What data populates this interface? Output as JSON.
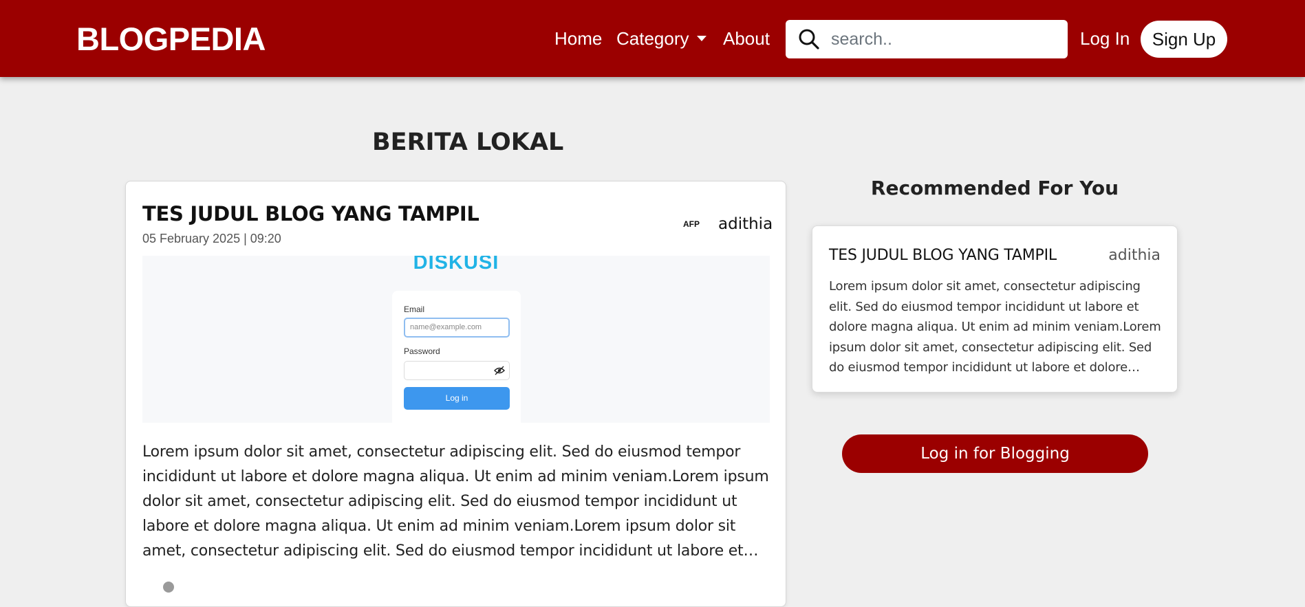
{
  "navbar": {
    "brand": "BLOGPEDIA",
    "links": {
      "home": "Home",
      "category": "Category",
      "about": "About",
      "login": "Log In",
      "signup": "Sign Up"
    },
    "search": {
      "placeholder": "search..",
      "value": ""
    },
    "colors": {
      "background": "#9b0000",
      "text": "#ffffff"
    }
  },
  "section": {
    "title": "BERITA LOKAL"
  },
  "post": {
    "title": "TES JUDUL BLOG YANG TAMPIL",
    "date": "05 February 2025 | 09:20",
    "source": "AFP",
    "author": "adithia",
    "image": {
      "heading": "DISKUSI",
      "email_label": "Email",
      "email_placeholder": "name@example.com",
      "password_label": "Password",
      "login_button": "Log in"
    },
    "excerpt": "Lorem ipsum dolor sit amet, consectetur adipiscing elit. Sed do eiusmod tempor incididunt ut labore et dolore magna aliqua. Ut enim ad minim veniam.Lorem ipsum dolor sit amet, consectetur adipiscing elit. Sed do eiusmod tempor incididunt ut labore et dolore magna aliqua. Ut enim ad minim veniam.Lorem ipsum dolor sit amet, consectetur adipiscing elit. Sed do eiusmod tempor incididunt ut labore et dolore magna aliqua."
  },
  "sidebar": {
    "title": "Recommended For You",
    "recommended": {
      "title": "TES JUDUL BLOG YANG TAMPIL",
      "author": "adithia",
      "excerpt": "Lorem ipsum dolor sit amet, consectetur adipiscing elit. Sed do eiusmod tempor incididunt ut labore et dolore magna aliqua. Ut enim ad minim veniam.Lorem ipsum dolor sit amet, consectetur adipiscing elit. Sed do eiusmod tempor incididunt ut labore et dolore magna aliqua."
    },
    "login_button": "Log in for Blogging"
  }
}
